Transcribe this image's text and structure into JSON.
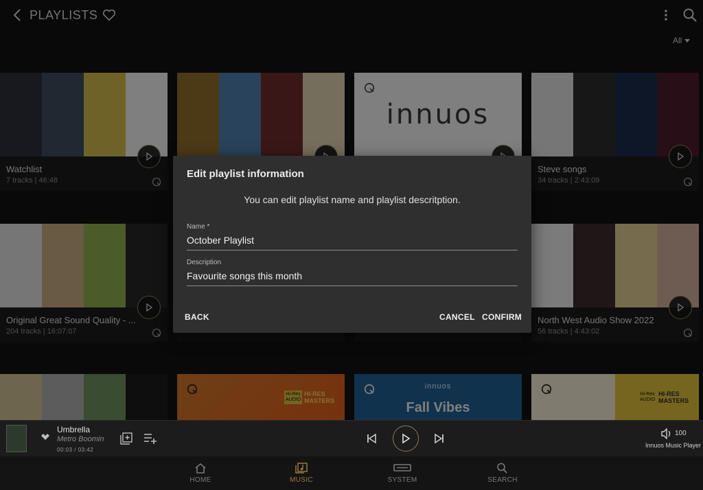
{
  "header": {
    "title": "PLAYLISTS",
    "filter_label": "All"
  },
  "playlists": [
    {
      "title": "Watchlist",
      "meta": "7 tracks | 46:48",
      "colors": [
        "#2b2f3a",
        "#3c4a5a",
        "#c8b24a",
        "#e7e7e7"
      ]
    },
    {
      "title": "",
      "meta": "",
      "colors": [
        "#8a6a2a",
        "#4a7aa6",
        "#6a2a2a",
        "#d8c8a8"
      ]
    },
    {
      "title": "",
      "meta": "",
      "colors": [
        "#e8e8e8"
      ]
    },
    {
      "title": "Steve songs",
      "meta": "34 tracks | 2:43:09",
      "colors": [
        "#d8d8d8",
        "#2a2a2a",
        "#1a2a4a",
        "#4a1a2a"
      ]
    },
    {
      "title": "Original Great Sound Quality - ...",
      "meta": "204 tracks | 16:07:07",
      "colors": [
        "#d8d8d8",
        "#bfa57a",
        "#8aa84a",
        "#262626"
      ]
    },
    {
      "title": "",
      "meta": "",
      "colors": [
        "#3a3a3a",
        "#4a4a4a"
      ]
    },
    {
      "title": "",
      "meta": "",
      "colors": [
        "#3a3a3a",
        "#4a4a4a"
      ]
    },
    {
      "title": "North West Audio Show 2022",
      "meta": "56 tracks | 4:43:02",
      "colors": [
        "#e0e0e0",
        "#3a2a2a",
        "#d8c48a",
        "#c8a898"
      ]
    },
    {
      "title": "",
      "meta": "",
      "colors": [
        "#c8b890",
        "#a8a8a8",
        "#6a8a5a",
        "#1a1a1a"
      ]
    },
    {
      "title": "",
      "meta": "",
      "colors": [
        "#c8742a",
        "#d85a1a"
      ]
    },
    {
      "title": "",
      "meta": "",
      "colors": [
        "#1e5c8c"
      ]
    },
    {
      "title": "",
      "meta": "",
      "colors": [
        "#e8e0c8",
        "#d8b83a"
      ]
    }
  ],
  "album_texts": {
    "innuos_logo": "innuos",
    "fall_vibes": "Fall Vibes",
    "hires_1": "Hi-Res",
    "hires_2": "HI-RES",
    "masters": "MASTERS",
    "audio": "AUDIO"
  },
  "dialog": {
    "title": "Edit playlist information",
    "text": "You can edit playlist name and playlist descritption.",
    "name_label": "Name *",
    "name_value": "October Playlist",
    "desc_label": "Description",
    "desc_value": "Favourite songs this month",
    "back_label": "BACK",
    "cancel_label": "CANCEL",
    "confirm_label": "CONFIRM"
  },
  "player": {
    "song": "Umbrella",
    "artist": "Metro Boomin",
    "time": "00:03 / 03:42",
    "volume": "100",
    "device": "Innuos Music Player"
  },
  "nav": {
    "home": "HOME",
    "music": "MUSIC",
    "system": "SYSTEM",
    "search": "SEARCH"
  },
  "colors": {
    "accent": "#9a7a3e",
    "dialog_bg": "#2f2f2f"
  }
}
